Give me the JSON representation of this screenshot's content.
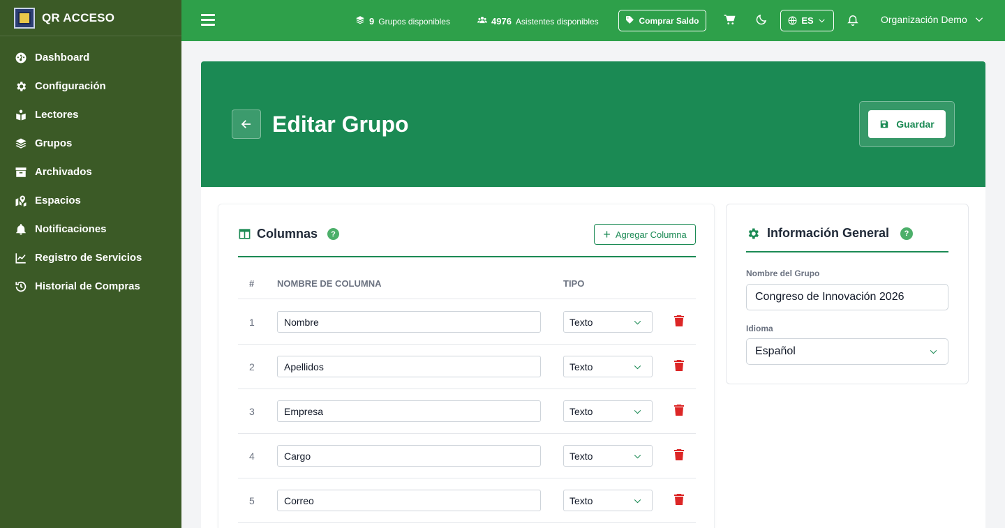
{
  "app": {
    "name": "QR ACCESO"
  },
  "sidebar": {
    "items": [
      {
        "label": "Dashboard",
        "icon": "gauge-icon"
      },
      {
        "label": "Configuración",
        "icon": "gear-icon"
      },
      {
        "label": "Lectores",
        "icon": "book-reader-icon"
      },
      {
        "label": "Grupos",
        "icon": "layers-icon"
      },
      {
        "label": "Archivados",
        "icon": "archive-icon"
      },
      {
        "label": "Espacios",
        "icon": "map-location-icon"
      },
      {
        "label": "Notificaciones",
        "icon": "bell-icon"
      },
      {
        "label": "Registro de Servicios",
        "icon": "chart-line-icon"
      },
      {
        "label": "Historial de Compras",
        "icon": "history-icon"
      }
    ]
  },
  "topbar": {
    "groups_count": "9",
    "groups_label": "Grupos disponibles",
    "attendees_count": "4976",
    "attendees_label": "Asistentes disponibles",
    "buy_label": "Comprar Saldo",
    "language": "ES",
    "organization": "Organización Demo"
  },
  "header": {
    "title": "Editar Grupo",
    "save_label": "Guardar"
  },
  "columns_card": {
    "title": "Columnas",
    "help": "?",
    "add_label": "Agregar Columna",
    "headers": {
      "num": "#",
      "name": "NOMBRE DE COLUMNA",
      "type": "TIPO"
    },
    "rows": [
      {
        "num": "1",
        "name": "Nombre",
        "type": "Texto"
      },
      {
        "num": "2",
        "name": "Apellidos",
        "type": "Texto"
      },
      {
        "num": "3",
        "name": "Empresa",
        "type": "Texto"
      },
      {
        "num": "4",
        "name": "Cargo",
        "type": "Texto"
      },
      {
        "num": "5",
        "name": "Correo",
        "type": "Texto"
      }
    ]
  },
  "info_card": {
    "title": "Información General",
    "help": "?",
    "group_name_label": "Nombre del Grupo",
    "group_name_value": "Congreso de Innovación 2026",
    "language_label": "Idioma",
    "language_value": "Español"
  },
  "colors": {
    "sidebar_bg": "#3b5a26",
    "topbar_bg": "#2ea04a",
    "accent": "#1b8a54",
    "danger": "#dc2626"
  }
}
